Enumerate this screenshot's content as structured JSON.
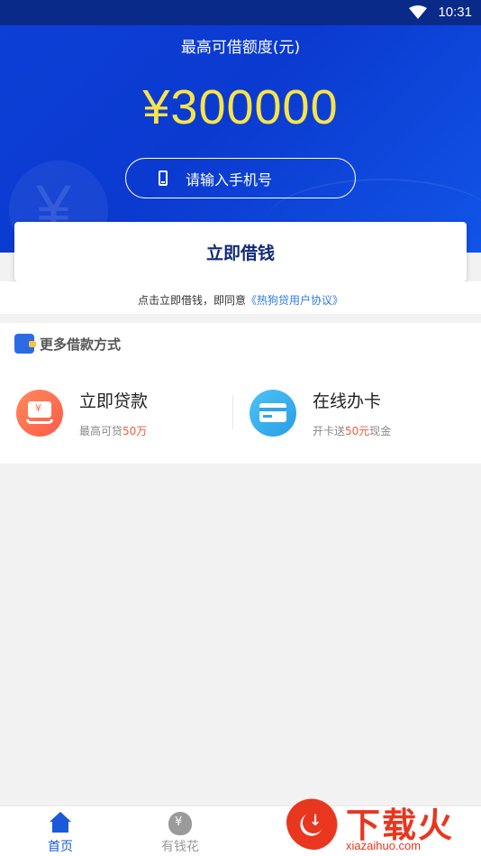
{
  "status_bar": {
    "time": "10:31",
    "wifi_icon": "wifi-icon"
  },
  "hero": {
    "title": "最高可借额度(元)",
    "amount": "¥300000",
    "phone_placeholder": "请输入手机号",
    "deco_symbol": "¥"
  },
  "borrow_button": {
    "label": "立即借钱"
  },
  "agreement": {
    "prefix": "点击立即借钱，即同意",
    "link": "《热狗贷用户协议》"
  },
  "more": {
    "title": "更多借款方式",
    "options": [
      {
        "name": "立即贷款",
        "desc_prefix": "最高可贷",
        "desc_highlight": "50万",
        "desc_suffix": "",
        "icon": "loan-icon",
        "icon_symbol": "¥"
      },
      {
        "name": "在线办卡",
        "desc_prefix": "开卡送",
        "desc_highlight": "50元",
        "desc_suffix": "现金",
        "icon": "card-icon"
      }
    ]
  },
  "tabbar": {
    "tabs": [
      {
        "label": "首页",
        "icon": "home-icon",
        "active": true
      },
      {
        "label": "有钱花",
        "icon": "money-bag-icon",
        "icon_symbol": "¥",
        "active": false
      }
    ]
  },
  "watermark": {
    "text": "下载火",
    "url": "xiazaihuo.com"
  },
  "colors": {
    "primary_blue": "#0b3ad0",
    "amount_yellow": "#f8e44a",
    "highlight_red": "#f05a3a",
    "link_blue": "#2e7be6"
  }
}
